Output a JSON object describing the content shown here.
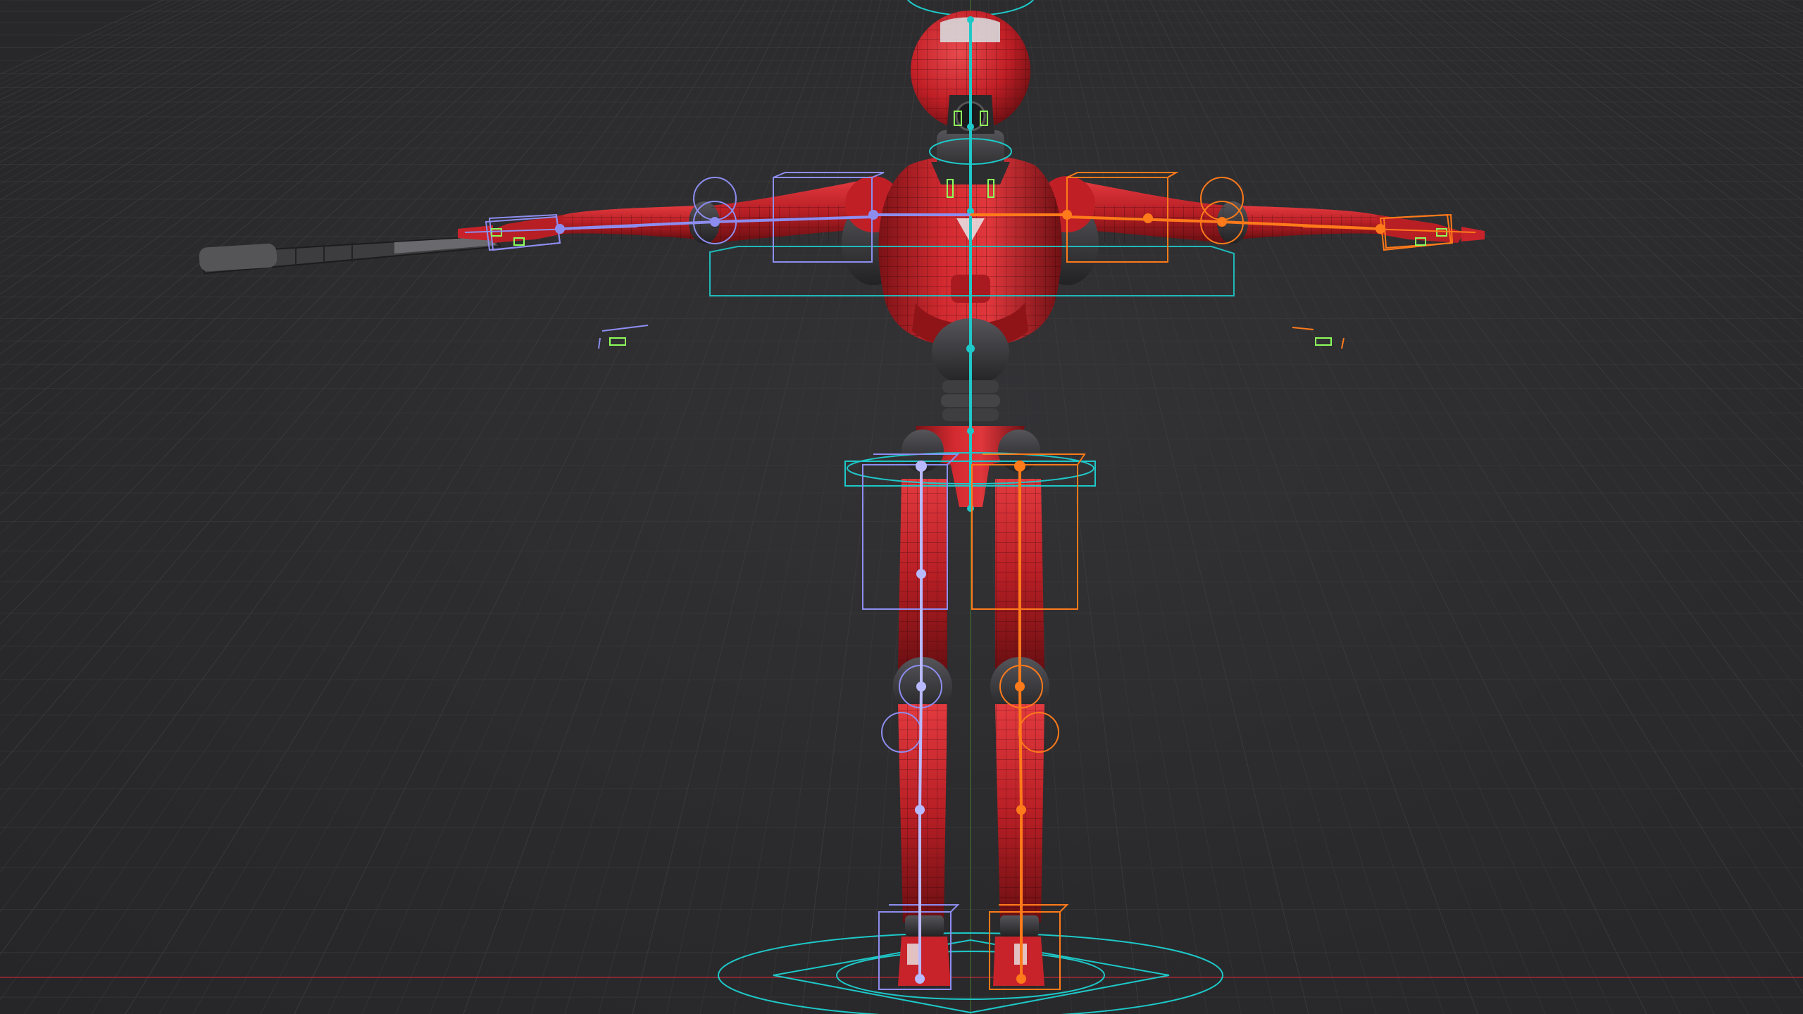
{
  "viewport": {
    "mode": "3d-viewport",
    "subject": "rigged-robot-t-pose",
    "grid": true
  },
  "colors": {
    "background": "#2b2b2d",
    "grid": "#3b3b3e",
    "robot_red": "#c8232a",
    "robot_red_dark": "#7a1216",
    "robot_dark_parts": "#3a3a3c",
    "center_bones": "#1ec8c8",
    "left_bones": "#8d8df0",
    "right_bones": "#ff7a1a",
    "ik_handles": "#8dff5a",
    "ground_axis_x": "#c8283a",
    "ground_axis_y": "#4a9a2a"
  },
  "icons": {
    "weapon": "rifle-icon",
    "wireframe": "wireframe-overlay"
  }
}
